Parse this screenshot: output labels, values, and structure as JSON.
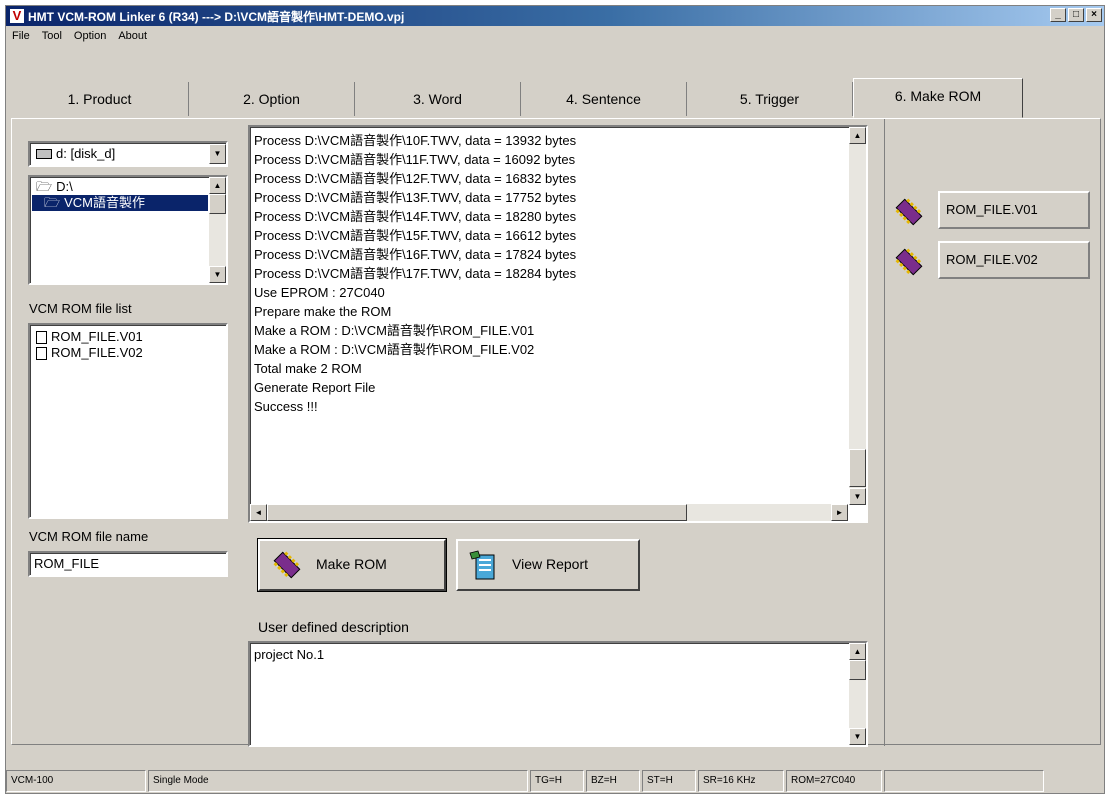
{
  "window": {
    "title": "HMT VCM-ROM Linker 6  (R34) ---> D:\\VCM語音製作\\HMT-DEMO.vpj",
    "app_icon_letter": "V",
    "minimize": "_",
    "maximize": "□",
    "close": "×"
  },
  "menu": [
    "File",
    "Tool",
    "Option",
    "About"
  ],
  "tabs": [
    "1. Product",
    "2. Option",
    "3. Word",
    "4. Sentence",
    "5. Trigger",
    "6. Make ROM"
  ],
  "active_tab": "6. Make ROM",
  "left": {
    "drive": "d: [disk_d]",
    "folders": [
      "D:\\",
      "VCM語音製作"
    ],
    "selected_folder": "VCM語音製作",
    "file_list_label": "VCM ROM file list",
    "files": [
      "ROM_FILE.V01",
      "ROM_FILE.V02"
    ],
    "file_name_label": "VCM ROM file name",
    "file_name_value": "ROM_FILE"
  },
  "log_lines": [
    "Process D:\\VCM語音製作\\10F.TWV, data = 13932 bytes",
    "Process D:\\VCM語音製作\\11F.TWV, data = 16092 bytes",
    "Process D:\\VCM語音製作\\12F.TWV, data = 16832 bytes",
    "Process D:\\VCM語音製作\\13F.TWV, data = 17752 bytes",
    "Process D:\\VCM語音製作\\14F.TWV, data = 18280 bytes",
    "Process D:\\VCM語音製作\\15F.TWV, data = 16612 bytes",
    "Process D:\\VCM語音製作\\16F.TWV, data = 17824 bytes",
    "Process D:\\VCM語音製作\\17F.TWV, data = 18284 bytes",
    "Use EPROM : 27C040",
    "Prepare make the ROM",
    "Make a ROM : D:\\VCM語音製作\\ROM_FILE.V01",
    "Make a ROM : D:\\VCM語音製作\\ROM_FILE.V02",
    "Total make 2 ROM",
    "Generate Report File",
    "Success !!!"
  ],
  "buttons": {
    "make_rom": "Make ROM",
    "view_report": "View Report"
  },
  "description": {
    "label": "User defined description",
    "value": "project No.1"
  },
  "rom_outputs": [
    "ROM_FILE.V01",
    "ROM_FILE.V02"
  ],
  "status": {
    "model": "VCM-100",
    "mode": "Single Mode",
    "tg": "TG=H",
    "bz": "BZ=H",
    "st": "ST=H",
    "sr": "SR=16 KHz",
    "rom": "ROM=27C040"
  },
  "colors": {
    "title_start": "#0a246a",
    "face": "#d4d0c8",
    "selection": "#0a246a",
    "chip_body": "#7a2d8c",
    "chip_pins": "#e6b800"
  }
}
